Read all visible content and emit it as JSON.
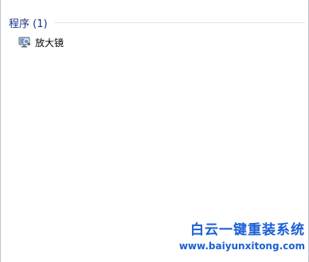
{
  "results": {
    "section_title": "程序 (1)",
    "items": [
      {
        "label": "放大镜",
        "icon": "magnifier-app-icon"
      }
    ]
  },
  "watermark": {
    "title": "白云一键重装系统",
    "url": "www.baiyunxitong.com"
  },
  "colors": {
    "section_title": "#1e3287",
    "divider": "#dde6f1",
    "watermark": "#1a5fd6"
  }
}
